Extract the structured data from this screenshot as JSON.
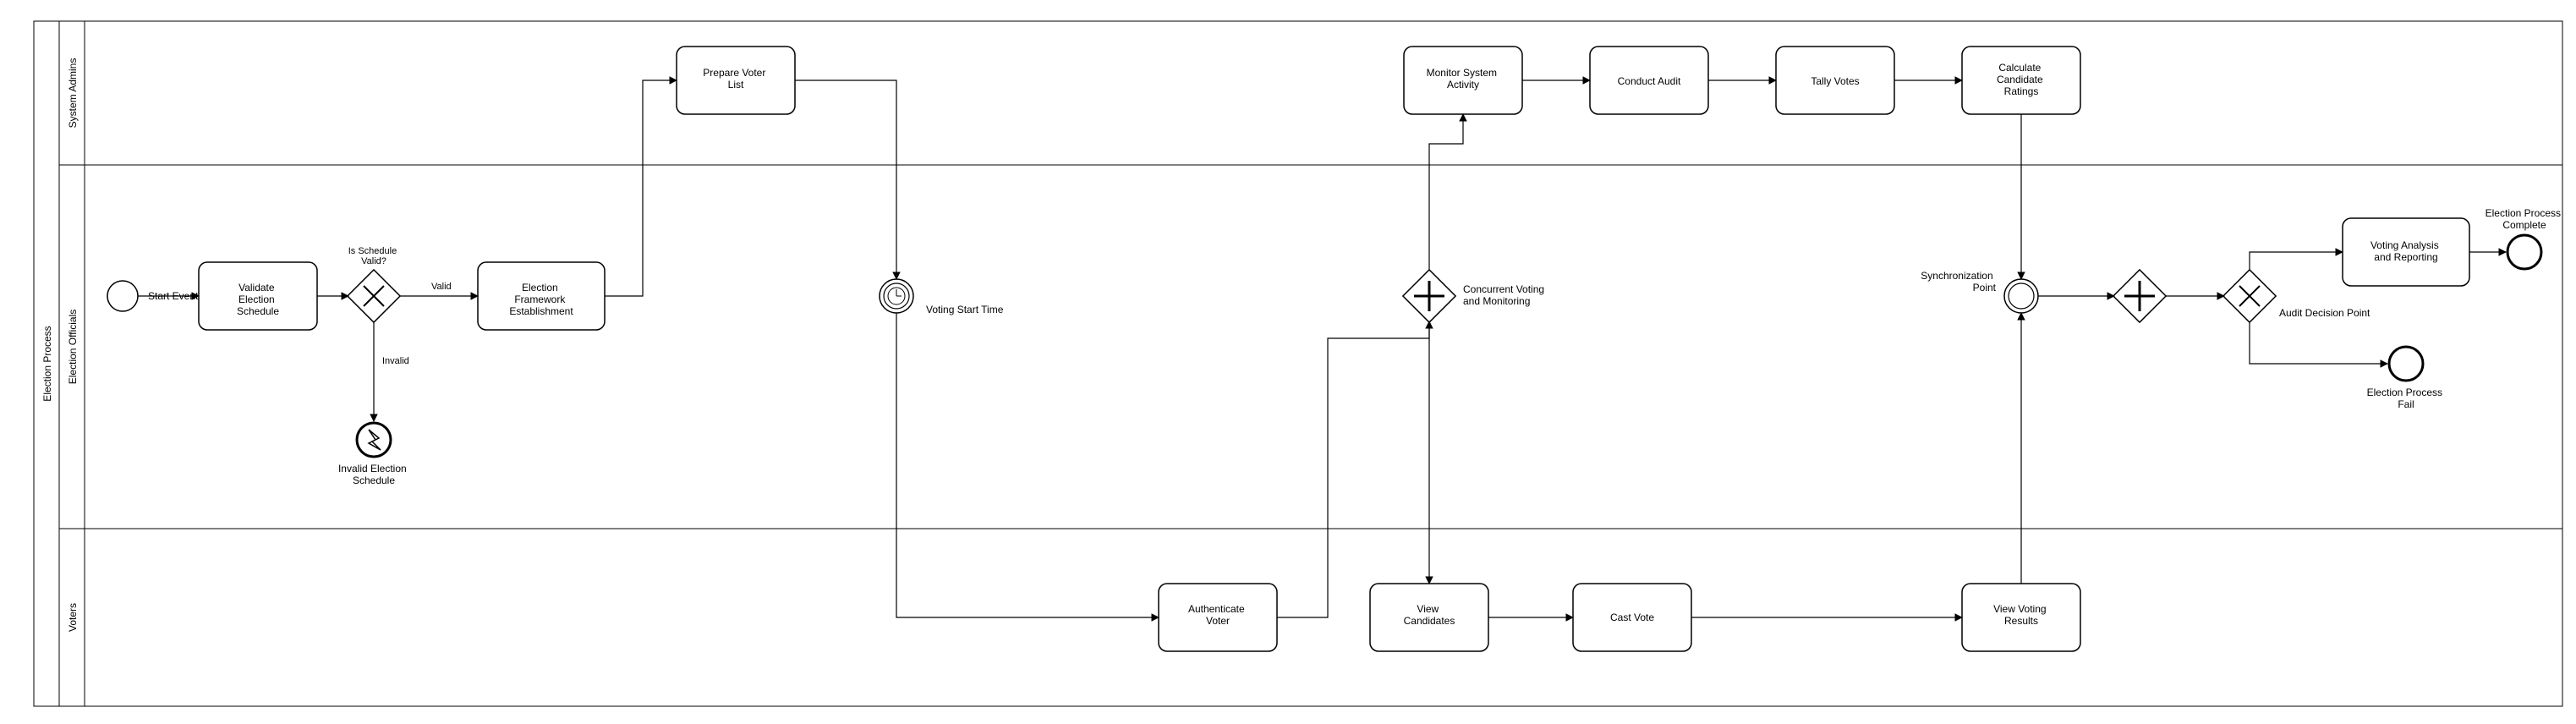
{
  "pool": {
    "name": "Election Process"
  },
  "lanes": {
    "admins": "System Admins",
    "officials": "Election Officials",
    "voters": "Voters"
  },
  "nodes": {
    "start": "Start Event",
    "validate_schedule": "Validate Election Schedule",
    "gw_schedule": "Is Schedule Valid?",
    "invalid_schedule": "Invalid Election Schedule",
    "framework": "Election Framework Establishment",
    "prepare_voter_list": "Prepare Voter List",
    "timer": "Voting Start Time",
    "authenticate": "Authenticate Voter",
    "gw_parallel": "Concurrent Voting and Monitoring",
    "monitor": "Monitor System Activity",
    "audit": "Conduct Audit",
    "tally": "Tally Votes",
    "ratings": "Calculate Candidate Ratings",
    "view_candidates": "View Candidates",
    "cast_vote": "Cast Vote",
    "view_results": "View Voting Results",
    "sync_label": "Synchronization Point",
    "gw_join": "",
    "gw_audit": "Audit Decision Point",
    "analysis": "Voting Analysis and Reporting",
    "end_success": "Election Process Complete",
    "end_fail": "Election Process Fail"
  },
  "edges": {
    "valid": "Valid",
    "invalid": "Invalid"
  },
  "chart_data": {
    "type": "bpmn",
    "pool": "Election Process",
    "lanes": [
      "System Admins",
      "Election Officials",
      "Voters"
    ],
    "elements": [
      {
        "id": "start",
        "type": "startEvent",
        "lane": "Election Officials",
        "label": "Start Event"
      },
      {
        "id": "validate_schedule",
        "type": "task",
        "lane": "Election Officials",
        "label": "Validate Election Schedule"
      },
      {
        "id": "gw_schedule",
        "type": "exclusiveGateway",
        "lane": "Election Officials",
        "label": "Is Schedule Valid?"
      },
      {
        "id": "invalid_schedule",
        "type": "errorEndEvent",
        "lane": "Election Officials",
        "label": "Invalid Election Schedule"
      },
      {
        "id": "framework",
        "type": "task",
        "lane": "Election Officials",
        "label": "Election Framework Establishment"
      },
      {
        "id": "prepare_voter_list",
        "type": "task",
        "lane": "System Admins",
        "label": "Prepare Voter List"
      },
      {
        "id": "timer",
        "type": "intermediateTimerEvent",
        "lane": "Election Officials",
        "label": "Voting Start Time"
      },
      {
        "id": "authenticate",
        "type": "task",
        "lane": "Voters",
        "label": "Authenticate Voter"
      },
      {
        "id": "gw_parallel",
        "type": "parallelGateway",
        "lane": "Election Officials",
        "label": "Concurrent Voting and Monitoring"
      },
      {
        "id": "monitor",
        "type": "task",
        "lane": "System Admins",
        "label": "Monitor System Activity"
      },
      {
        "id": "audit",
        "type": "task",
        "lane": "System Admins",
        "label": "Conduct Audit"
      },
      {
        "id": "tally",
        "type": "task",
        "lane": "System Admins",
        "label": "Tally Votes"
      },
      {
        "id": "ratings",
        "type": "task",
        "lane": "System Admins",
        "label": "Calculate Candidate Ratings"
      },
      {
        "id": "view_candidates",
        "type": "task",
        "lane": "Voters",
        "label": "View Candidates"
      },
      {
        "id": "cast_vote",
        "type": "task",
        "lane": "Voters",
        "label": "Cast Vote"
      },
      {
        "id": "view_results",
        "type": "task",
        "lane": "Voters",
        "label": "View Voting Results"
      },
      {
        "id": "sync",
        "type": "intermediateEvent",
        "lane": "Election Officials",
        "label": "Synchronization Point"
      },
      {
        "id": "gw_join",
        "type": "parallelGateway",
        "lane": "Election Officials",
        "label": ""
      },
      {
        "id": "gw_audit",
        "type": "exclusiveGateway",
        "lane": "Election Officials",
        "label": "Audit Decision Point"
      },
      {
        "id": "analysis",
        "type": "task",
        "lane": "Election Officials",
        "label": "Voting Analysis and Reporting"
      },
      {
        "id": "end_success",
        "type": "endEvent",
        "lane": "Election Officials",
        "label": "Election Process Complete"
      },
      {
        "id": "end_fail",
        "type": "endEvent",
        "lane": "Election Officials",
        "label": "Election Process Fail"
      }
    ],
    "flows": [
      {
        "from": "start",
        "to": "validate_schedule"
      },
      {
        "from": "validate_schedule",
        "to": "gw_schedule"
      },
      {
        "from": "gw_schedule",
        "to": "framework",
        "label": "Valid"
      },
      {
        "from": "gw_schedule",
        "to": "invalid_schedule",
        "label": "Invalid"
      },
      {
        "from": "framework",
        "to": "prepare_voter_list"
      },
      {
        "from": "prepare_voter_list",
        "to": "timer"
      },
      {
        "from": "timer",
        "to": "authenticate"
      },
      {
        "from": "authenticate",
        "to": "gw_parallel"
      },
      {
        "from": "gw_parallel",
        "to": "monitor"
      },
      {
        "from": "gw_parallel",
        "to": "view_candidates"
      },
      {
        "from": "monitor",
        "to": "audit"
      },
      {
        "from": "audit",
        "to": "tally"
      },
      {
        "from": "tally",
        "to": "ratings"
      },
      {
        "from": "view_candidates",
        "to": "cast_vote"
      },
      {
        "from": "cast_vote",
        "to": "view_results"
      },
      {
        "from": "ratings",
        "to": "sync"
      },
      {
        "from": "view_results",
        "to": "sync"
      },
      {
        "from": "sync",
        "to": "gw_join"
      },
      {
        "from": "gw_join",
        "to": "gw_audit"
      },
      {
        "from": "gw_audit",
        "to": "analysis"
      },
      {
        "from": "gw_audit",
        "to": "end_fail"
      },
      {
        "from": "analysis",
        "to": "end_success"
      }
    ]
  }
}
